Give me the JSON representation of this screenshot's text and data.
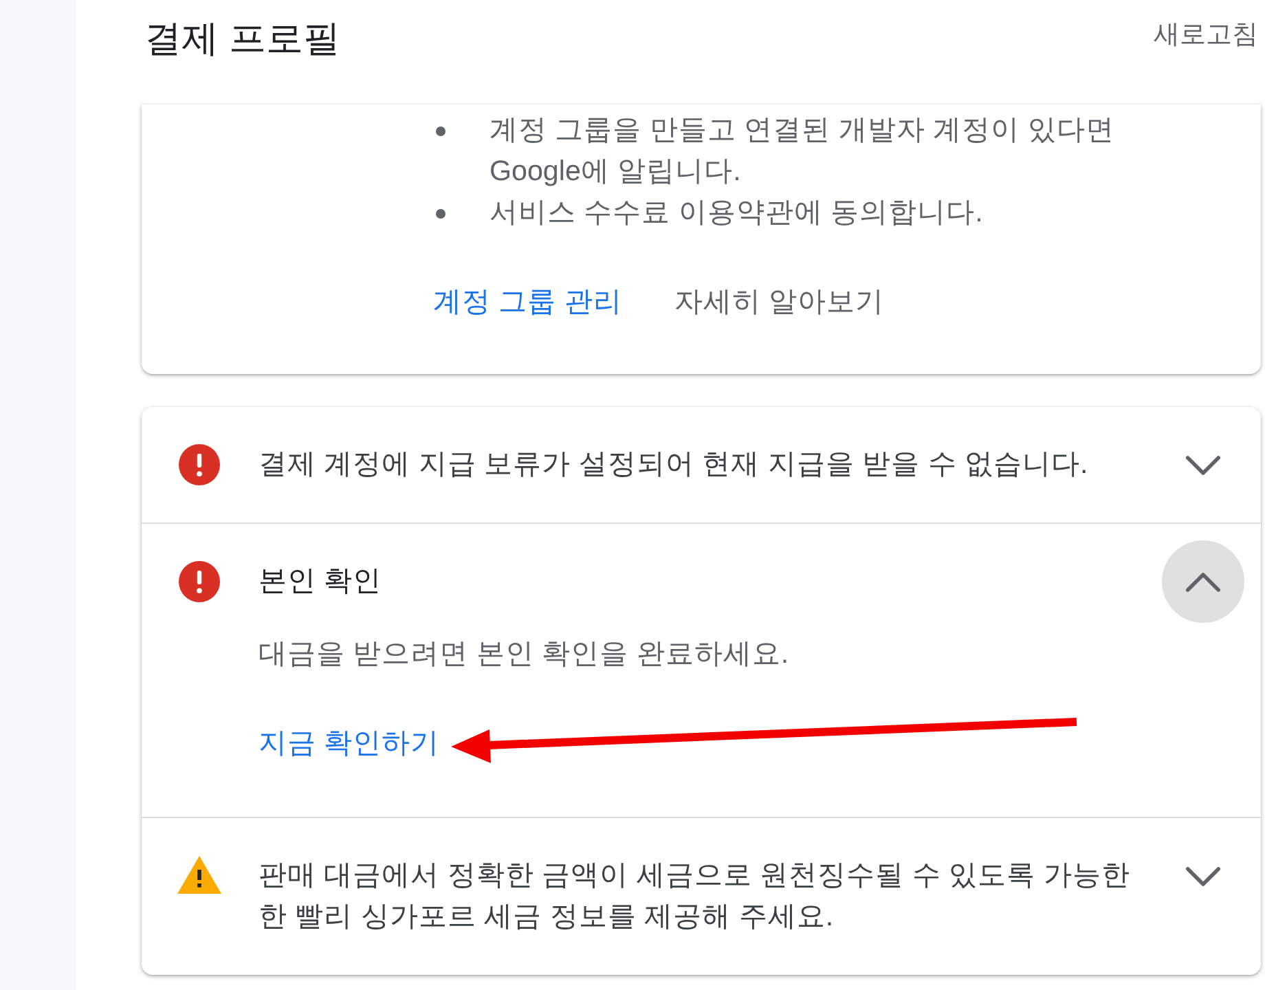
{
  "header": {
    "title": "결제 프로필",
    "refresh_label": "새로고침"
  },
  "account_group_card": {
    "bullets": [
      "계정 그룹을 만들고 연결된 개발자 계정이 있다면 Google에 알립니다.",
      "서비스 수수료 이용약관에 동의합니다."
    ],
    "links": [
      {
        "label": "계정 그룹 관리",
        "kind": "primary"
      },
      {
        "label": "자세히 알아보기",
        "kind": "secondary"
      }
    ]
  },
  "alerts": [
    {
      "kind": "error",
      "text": "결제 계정에 지급 보류가 설정되어 현재 지급을 받을 수 없습니다.",
      "expanded": false
    },
    {
      "kind": "error",
      "text": "본인 확인",
      "expanded": true,
      "description": "대금을 받으려면 본인 확인을 완료하세요.",
      "action": {
        "label": "지금 확인하기",
        "arrow": true
      }
    },
    {
      "kind": "warning",
      "text": "판매 대금에서 정확한 금액이 세금으로 원천징수될 수 있도록 가능한 한 빨리 싱가포르 세금 정보를 제공해 주세요.",
      "expanded": false
    }
  ]
}
